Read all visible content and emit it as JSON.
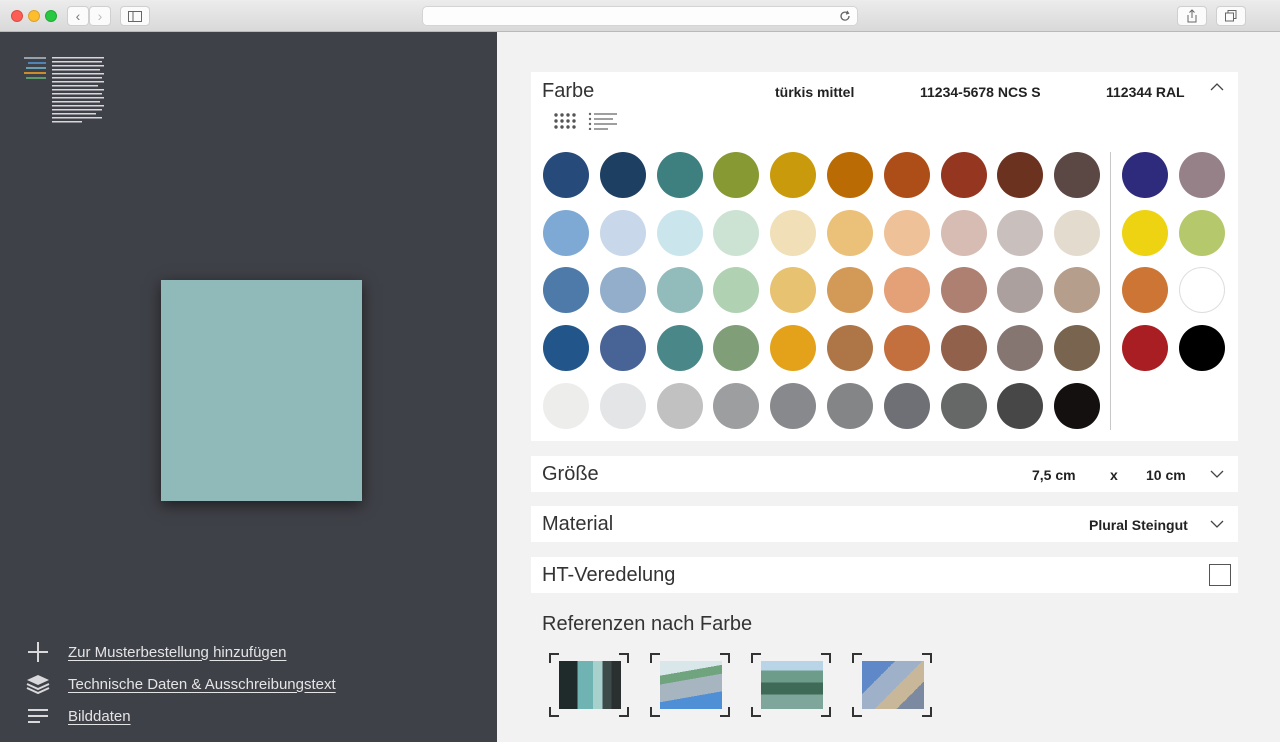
{
  "colors": {
    "swatch_selected": "#8fbab9",
    "left_bg": "#3f4148"
  },
  "left": {
    "actions": [
      {
        "icon": "plus-icon",
        "label": "Zur Musterbestellung hinzufügen"
      },
      {
        "icon": "layers-icon",
        "label": "Technische Daten & Ausschreibungstext"
      },
      {
        "icon": "lines-icon",
        "label": "Bilddaten"
      }
    ]
  },
  "farbe": {
    "title": "Farbe",
    "name": "türkis mittel",
    "ncs": "11234-5678 NCS S",
    "ral": "112344 RAL",
    "grid": [
      [
        "#264a7a",
        "#1d3f62",
        "#3e7f80",
        "#869933",
        "#c99a0b",
        "#bb6b04",
        "#ad4e19",
        "#953620",
        "#6c3220",
        "#5b4743"
      ],
      [
        "#7ea9d5",
        "#c8d7e9",
        "#cbe5ed",
        "#cce3d3",
        "#f0dfb7",
        "#ebc17a",
        "#efc198",
        "#d6bcb2",
        "#c9c0bd",
        "#e4dbcf"
      ],
      [
        "#4d7aa8",
        "#92aecb",
        "#92bcbb",
        "#b0d1b2",
        "#e6c271",
        "#d39a57",
        "#e4a077",
        "#ad8071",
        "#aba09e",
        "#b59e8b"
      ],
      [
        "#22568a",
        "#486496",
        "#4a8789",
        "#809f79",
        "#e3a21a",
        "#ae7647",
        "#c3703e",
        "#92614c",
        "#857671",
        "#78644f"
      ],
      [
        "#ededeb",
        "#e4e5e7",
        "#c1c1c1",
        "#9c9e9f",
        "#88898c",
        "#838587",
        "#6f7075",
        "#666767",
        "#474747",
        "#151010"
      ]
    ],
    "side": [
      [
        "#2e2b7d",
        "#978189"
      ],
      [
        "#edd311",
        "#b5c86b"
      ],
      [
        "#cc7535",
        "#ffffff"
      ],
      [
        "#a91e22",
        "#000000"
      ]
    ]
  },
  "groesse": {
    "title": "Größe",
    "width": "7,5 cm",
    "x": "x",
    "height": "10 cm"
  },
  "material": {
    "title": "Material",
    "value": "Plural Steingut"
  },
  "ht": {
    "title": "HT-Veredelung"
  },
  "referenzen": {
    "title": "Referenzen nach Farbe"
  }
}
